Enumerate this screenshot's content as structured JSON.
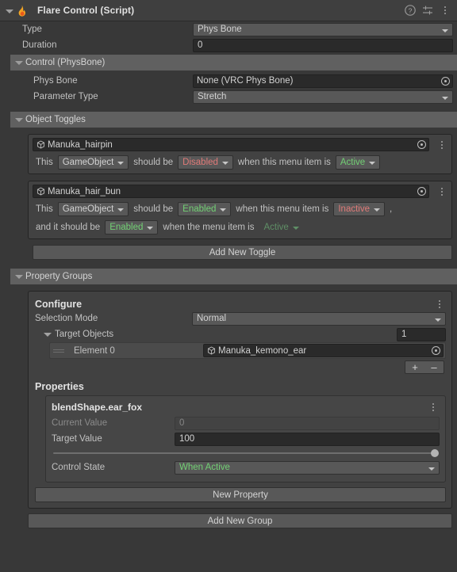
{
  "header": {
    "title": "Flare Control (Script)",
    "icon": "flame-icon",
    "help_icon": "help-icon",
    "preset_icon": "preset-icon",
    "menu_icon": "kebab-menu-icon"
  },
  "top_fields": [
    {
      "label": "Type",
      "value": "Phys Bone",
      "kind": "popup"
    },
    {
      "label": "Duration",
      "value": "0",
      "kind": "text"
    }
  ],
  "control_section": {
    "title": "Control (PhysBone)",
    "fields": [
      {
        "label": "Phys Bone",
        "value": "None (VRC Phys Bone)",
        "kind": "object"
      },
      {
        "label": "Parameter Type",
        "value": "Stretch",
        "kind": "popup"
      }
    ]
  },
  "object_toggles": {
    "title": "Object Toggles",
    "add_button": "Add New Toggle",
    "toggles": [
      {
        "object_name": "Manuka_hairpin",
        "lines": [
          {
            "prefix": "This",
            "type_value": "GameObject",
            "mid": "should be",
            "state_value": "Disabled",
            "state_color": "red",
            "suffix": "when this menu item is",
            "menu_value": "Active",
            "menu_color": "green",
            "trailing": ""
          }
        ]
      },
      {
        "object_name": "Manuka_hair_bun",
        "lines": [
          {
            "prefix": "This",
            "type_value": "GameObject",
            "mid": "should be",
            "state_value": "Enabled",
            "state_color": "green",
            "suffix": "when this menu item is",
            "menu_value": "Inactive",
            "menu_color": "red",
            "trailing": ","
          },
          {
            "prefix": "and it should be",
            "type_value": "",
            "mid": "",
            "state_value": "Enabled",
            "state_color": "green",
            "suffix": "when the menu item is",
            "menu_value": "Active",
            "menu_color": "green-dim",
            "trailing": ""
          }
        ]
      }
    ]
  },
  "property_groups": {
    "title": "Property Groups",
    "add_button": "Add New Group",
    "group": {
      "title": "Configure",
      "menu_icon": "kebab-menu-icon",
      "selection_mode": {
        "label": "Selection Mode",
        "value": "Normal"
      },
      "target_objects": {
        "label": "Target Objects",
        "size": "1",
        "elements": [
          {
            "label": "Element 0",
            "value": "Manuka_kemono_ear"
          }
        ],
        "add_label": "+",
        "remove_label": "–"
      },
      "properties_title": "Properties",
      "new_property_button": "New Property",
      "properties": [
        {
          "name": "blendShape.ear_fox",
          "current_value_label": "Current Value",
          "current_value": "0",
          "target_value_label": "Target Value",
          "target_value": "100",
          "slider_percent": 100,
          "control_state_label": "Control State",
          "control_state_value": "When Active"
        }
      ]
    }
  },
  "colors": {
    "green": "#72d074",
    "red": "#e07a78",
    "green_dim": "#5f8f66",
    "background": "#383838",
    "header_bar": "#606060"
  }
}
